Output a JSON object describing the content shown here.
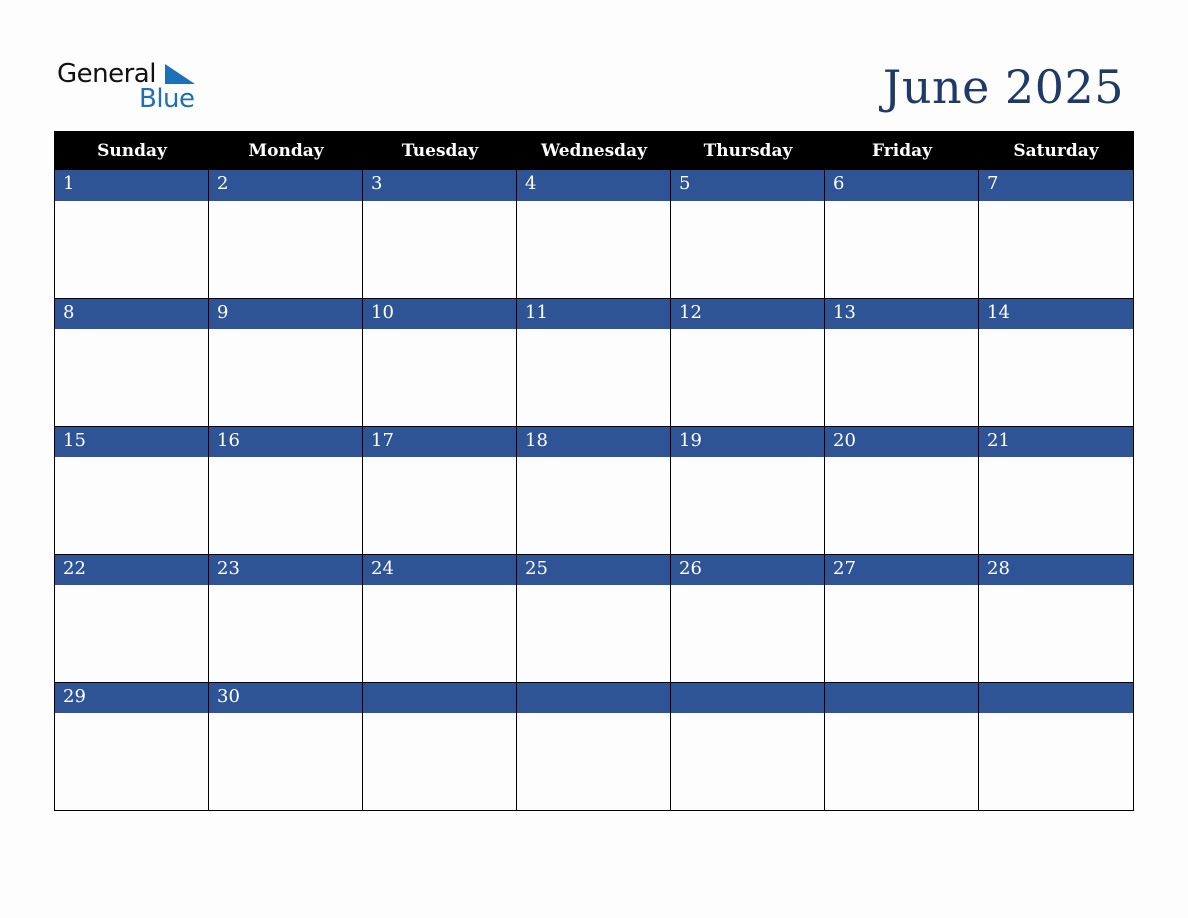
{
  "logo": {
    "line1": "General",
    "line2": "Blue"
  },
  "title": "June 2025",
  "colors": {
    "header_bg": "#000000",
    "day_band": "#2e5495",
    "title": "#1f3a68",
    "logo_blue": "#1d6fb8"
  },
  "weekdays": [
    "Sunday",
    "Monday",
    "Tuesday",
    "Wednesday",
    "Thursday",
    "Friday",
    "Saturday"
  ],
  "weeks": [
    [
      "1",
      "2",
      "3",
      "4",
      "5",
      "6",
      "7"
    ],
    [
      "8",
      "9",
      "10",
      "11",
      "12",
      "13",
      "14"
    ],
    [
      "15",
      "16",
      "17",
      "18",
      "19",
      "20",
      "21"
    ],
    [
      "22",
      "23",
      "24",
      "25",
      "26",
      "27",
      "28"
    ],
    [
      "29",
      "30",
      "",
      "",
      "",
      "",
      ""
    ]
  ]
}
